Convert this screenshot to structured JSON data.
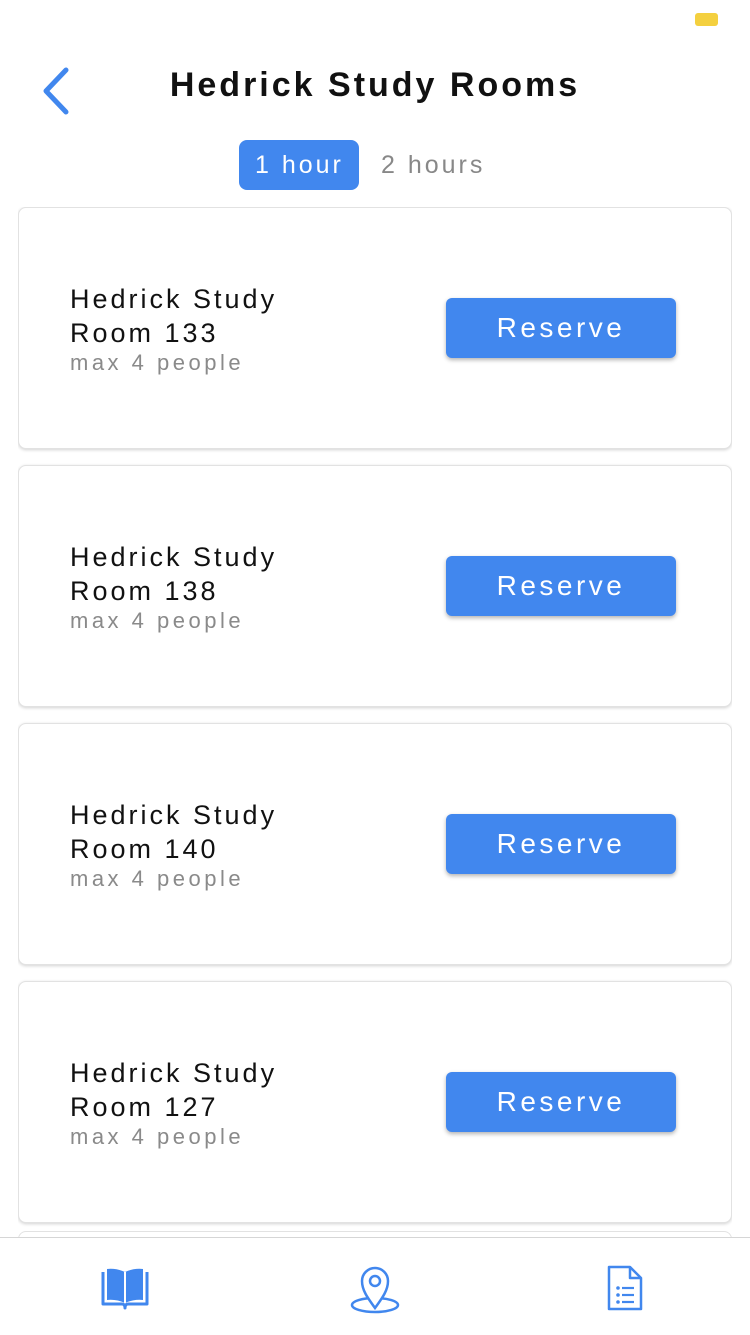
{
  "header": {
    "title": "Hedrick Study Rooms",
    "back_icon": "chevron-left-icon"
  },
  "duration": {
    "options": [
      "1 hour",
      "2 hours"
    ],
    "selected": "1 hour"
  },
  "rooms": [
    {
      "name": "Hedrick Study Room 133",
      "capacity": "max 4 people",
      "action": "Reserve"
    },
    {
      "name": "Hedrick Study Room 138",
      "capacity": "max 4 people",
      "action": "Reserve"
    },
    {
      "name": "Hedrick Study Room 140",
      "capacity": "max 4 people",
      "action": "Reserve"
    },
    {
      "name": "Hedrick Study Room 127",
      "capacity": "max 4 people",
      "action": "Reserve"
    }
  ],
  "tabbar": {
    "items": [
      {
        "icon": "book-icon"
      },
      {
        "icon": "map-pin-icon"
      },
      {
        "icon": "document-list-icon"
      }
    ]
  },
  "colors": {
    "accent": "#4187ee",
    "battery": "#f4d03f"
  }
}
